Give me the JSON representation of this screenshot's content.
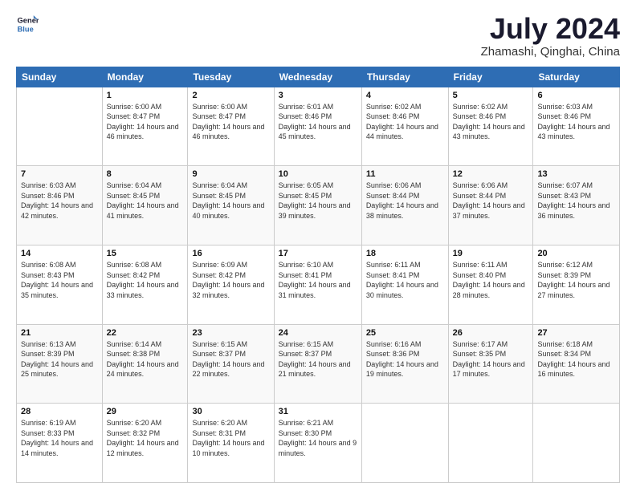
{
  "logo": {
    "line1": "General",
    "line2": "Blue"
  },
  "title": "July 2024",
  "location": "Zhamashi, Qinghai, China",
  "days_of_week": [
    "Sunday",
    "Monday",
    "Tuesday",
    "Wednesday",
    "Thursday",
    "Friday",
    "Saturday"
  ],
  "weeks": [
    [
      {
        "day": "",
        "sunrise": "",
        "sunset": "",
        "daylight": ""
      },
      {
        "day": "1",
        "sunrise": "Sunrise: 6:00 AM",
        "sunset": "Sunset: 8:47 PM",
        "daylight": "Daylight: 14 hours and 46 minutes."
      },
      {
        "day": "2",
        "sunrise": "Sunrise: 6:00 AM",
        "sunset": "Sunset: 8:47 PM",
        "daylight": "Daylight: 14 hours and 46 minutes."
      },
      {
        "day": "3",
        "sunrise": "Sunrise: 6:01 AM",
        "sunset": "Sunset: 8:46 PM",
        "daylight": "Daylight: 14 hours and 45 minutes."
      },
      {
        "day": "4",
        "sunrise": "Sunrise: 6:02 AM",
        "sunset": "Sunset: 8:46 PM",
        "daylight": "Daylight: 14 hours and 44 minutes."
      },
      {
        "day": "5",
        "sunrise": "Sunrise: 6:02 AM",
        "sunset": "Sunset: 8:46 PM",
        "daylight": "Daylight: 14 hours and 43 minutes."
      },
      {
        "day": "6",
        "sunrise": "Sunrise: 6:03 AM",
        "sunset": "Sunset: 8:46 PM",
        "daylight": "Daylight: 14 hours and 43 minutes."
      }
    ],
    [
      {
        "day": "7",
        "sunrise": "Sunrise: 6:03 AM",
        "sunset": "Sunset: 8:46 PM",
        "daylight": "Daylight: 14 hours and 42 minutes."
      },
      {
        "day": "8",
        "sunrise": "Sunrise: 6:04 AM",
        "sunset": "Sunset: 8:45 PM",
        "daylight": "Daylight: 14 hours and 41 minutes."
      },
      {
        "day": "9",
        "sunrise": "Sunrise: 6:04 AM",
        "sunset": "Sunset: 8:45 PM",
        "daylight": "Daylight: 14 hours and 40 minutes."
      },
      {
        "day": "10",
        "sunrise": "Sunrise: 6:05 AM",
        "sunset": "Sunset: 8:45 PM",
        "daylight": "Daylight: 14 hours and 39 minutes."
      },
      {
        "day": "11",
        "sunrise": "Sunrise: 6:06 AM",
        "sunset": "Sunset: 8:44 PM",
        "daylight": "Daylight: 14 hours and 38 minutes."
      },
      {
        "day": "12",
        "sunrise": "Sunrise: 6:06 AM",
        "sunset": "Sunset: 8:44 PM",
        "daylight": "Daylight: 14 hours and 37 minutes."
      },
      {
        "day": "13",
        "sunrise": "Sunrise: 6:07 AM",
        "sunset": "Sunset: 8:43 PM",
        "daylight": "Daylight: 14 hours and 36 minutes."
      }
    ],
    [
      {
        "day": "14",
        "sunrise": "Sunrise: 6:08 AM",
        "sunset": "Sunset: 8:43 PM",
        "daylight": "Daylight: 14 hours and 35 minutes."
      },
      {
        "day": "15",
        "sunrise": "Sunrise: 6:08 AM",
        "sunset": "Sunset: 8:42 PM",
        "daylight": "Daylight: 14 hours and 33 minutes."
      },
      {
        "day": "16",
        "sunrise": "Sunrise: 6:09 AM",
        "sunset": "Sunset: 8:42 PM",
        "daylight": "Daylight: 14 hours and 32 minutes."
      },
      {
        "day": "17",
        "sunrise": "Sunrise: 6:10 AM",
        "sunset": "Sunset: 8:41 PM",
        "daylight": "Daylight: 14 hours and 31 minutes."
      },
      {
        "day": "18",
        "sunrise": "Sunrise: 6:11 AM",
        "sunset": "Sunset: 8:41 PM",
        "daylight": "Daylight: 14 hours and 30 minutes."
      },
      {
        "day": "19",
        "sunrise": "Sunrise: 6:11 AM",
        "sunset": "Sunset: 8:40 PM",
        "daylight": "Daylight: 14 hours and 28 minutes."
      },
      {
        "day": "20",
        "sunrise": "Sunrise: 6:12 AM",
        "sunset": "Sunset: 8:39 PM",
        "daylight": "Daylight: 14 hours and 27 minutes."
      }
    ],
    [
      {
        "day": "21",
        "sunrise": "Sunrise: 6:13 AM",
        "sunset": "Sunset: 8:39 PM",
        "daylight": "Daylight: 14 hours and 25 minutes."
      },
      {
        "day": "22",
        "sunrise": "Sunrise: 6:14 AM",
        "sunset": "Sunset: 8:38 PM",
        "daylight": "Daylight: 14 hours and 24 minutes."
      },
      {
        "day": "23",
        "sunrise": "Sunrise: 6:15 AM",
        "sunset": "Sunset: 8:37 PM",
        "daylight": "Daylight: 14 hours and 22 minutes."
      },
      {
        "day": "24",
        "sunrise": "Sunrise: 6:15 AM",
        "sunset": "Sunset: 8:37 PM",
        "daylight": "Daylight: 14 hours and 21 minutes."
      },
      {
        "day": "25",
        "sunrise": "Sunrise: 6:16 AM",
        "sunset": "Sunset: 8:36 PM",
        "daylight": "Daylight: 14 hours and 19 minutes."
      },
      {
        "day": "26",
        "sunrise": "Sunrise: 6:17 AM",
        "sunset": "Sunset: 8:35 PM",
        "daylight": "Daylight: 14 hours and 17 minutes."
      },
      {
        "day": "27",
        "sunrise": "Sunrise: 6:18 AM",
        "sunset": "Sunset: 8:34 PM",
        "daylight": "Daylight: 14 hours and 16 minutes."
      }
    ],
    [
      {
        "day": "28",
        "sunrise": "Sunrise: 6:19 AM",
        "sunset": "Sunset: 8:33 PM",
        "daylight": "Daylight: 14 hours and 14 minutes."
      },
      {
        "day": "29",
        "sunrise": "Sunrise: 6:20 AM",
        "sunset": "Sunset: 8:32 PM",
        "daylight": "Daylight: 14 hours and 12 minutes."
      },
      {
        "day": "30",
        "sunrise": "Sunrise: 6:20 AM",
        "sunset": "Sunset: 8:31 PM",
        "daylight": "Daylight: 14 hours and 10 minutes."
      },
      {
        "day": "31",
        "sunrise": "Sunrise: 6:21 AM",
        "sunset": "Sunset: 8:30 PM",
        "daylight": "Daylight: 14 hours and 9 minutes."
      },
      {
        "day": "",
        "sunrise": "",
        "sunset": "",
        "daylight": ""
      },
      {
        "day": "",
        "sunrise": "",
        "sunset": "",
        "daylight": ""
      },
      {
        "day": "",
        "sunrise": "",
        "sunset": "",
        "daylight": ""
      }
    ]
  ]
}
